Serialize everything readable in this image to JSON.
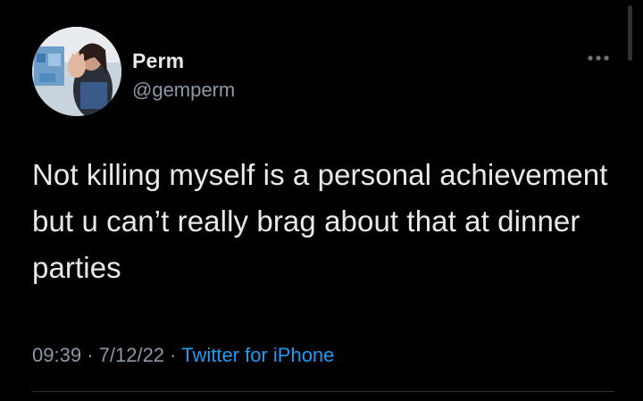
{
  "user": {
    "display_name": "Perm",
    "handle": "@gemperm"
  },
  "tweet": {
    "text": "Not killing myself is a personal achievement but u can’t really brag about that at dinner parties",
    "time": "09:39",
    "date": "7/12/22",
    "separator": "·",
    "source": "Twitter for iPhone"
  },
  "icons": {
    "more": "more-horizontal-icon",
    "avatar": "avatar-photo"
  },
  "colors": {
    "background": "#000000",
    "text": "#e7e9ea",
    "secondary_text": "#8b98a5",
    "link": "#1d9bf0"
  }
}
